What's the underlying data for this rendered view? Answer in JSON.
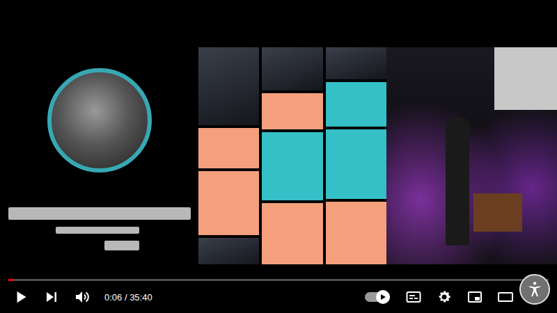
{
  "player": {
    "progress": {
      "level": 0.01
    },
    "time": "0:06 / 35:40",
    "autoplay": {
      "on": true
    },
    "captions": {
      "on": false
    }
  }
}
